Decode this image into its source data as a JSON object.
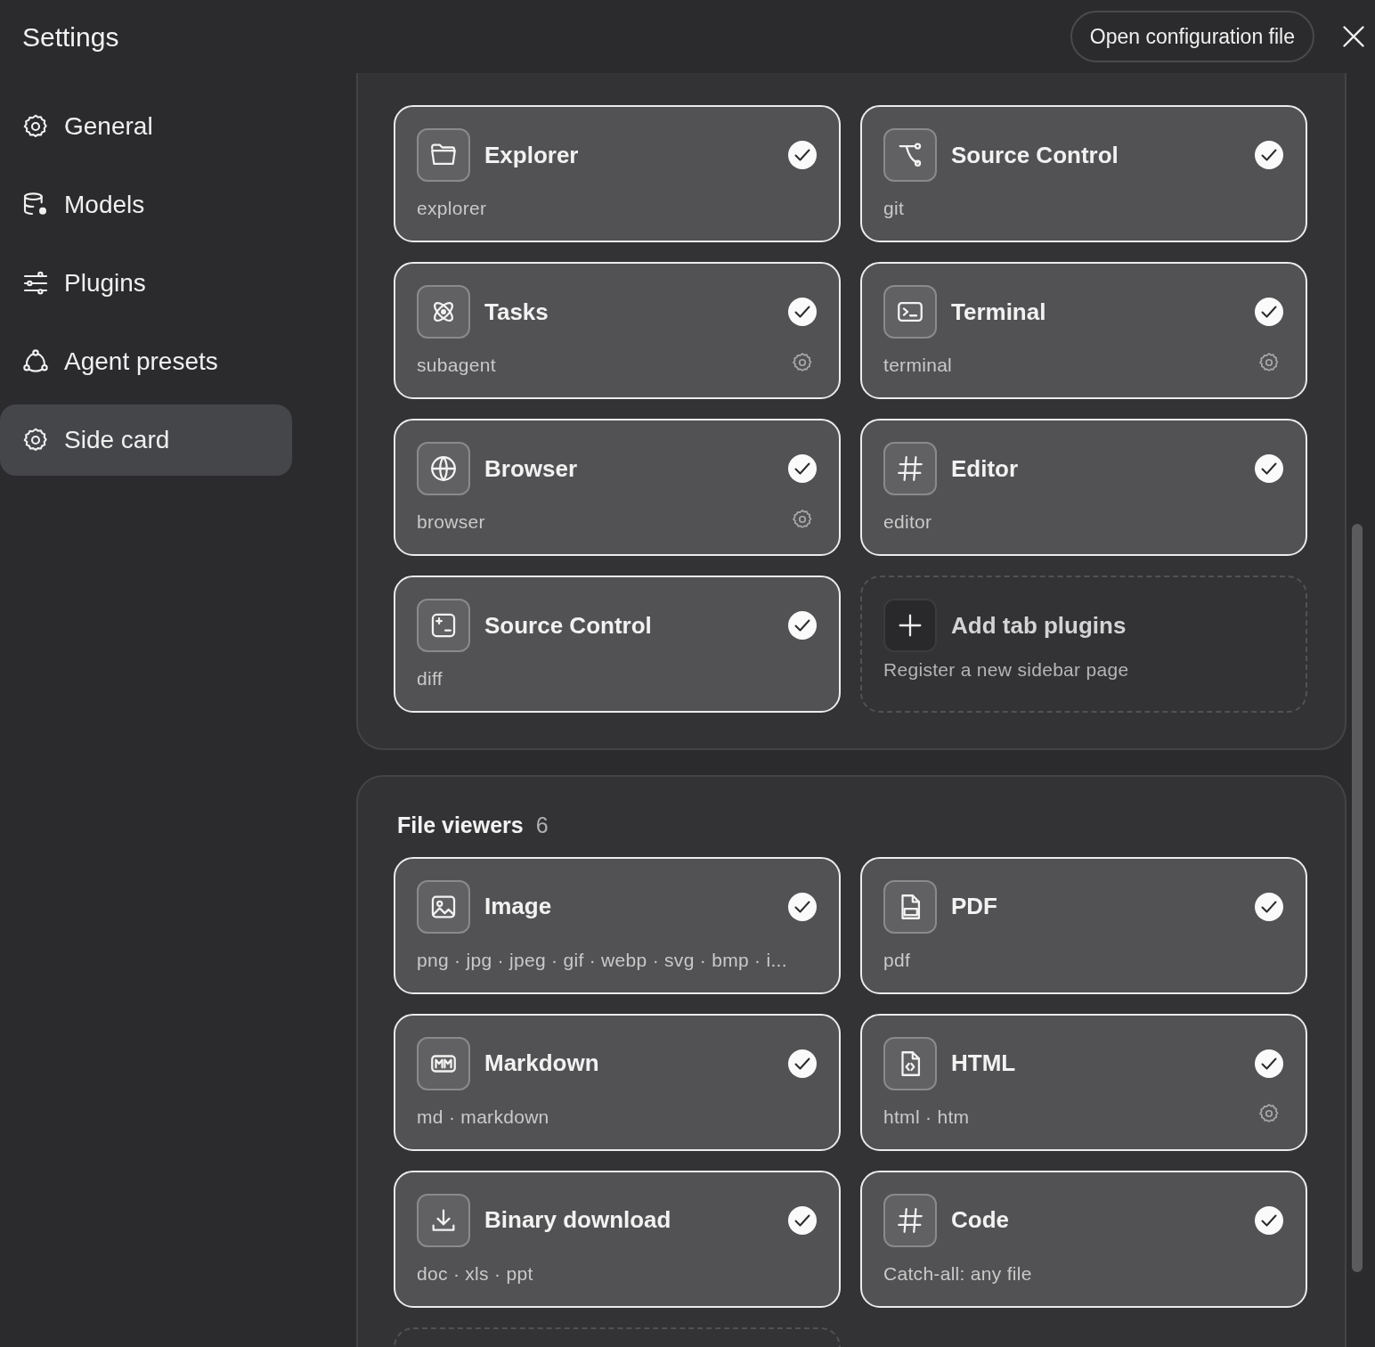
{
  "window": {
    "title": "Settings",
    "action_button": "Open configuration file"
  },
  "sidebar": {
    "items": [
      {
        "label": "General",
        "selected": false
      },
      {
        "label": "Models",
        "selected": false
      },
      {
        "label": "Plugins",
        "selected": false
      },
      {
        "label": "Agent presets",
        "selected": false
      },
      {
        "label": "Side card",
        "selected": true
      }
    ]
  },
  "sections": [
    {
      "items": [
        {
          "kind": "plugin",
          "title": "Explorer",
          "subtitle": "explorer",
          "checked": true,
          "settings": false
        },
        {
          "kind": "plugin",
          "title": "Source Control",
          "subtitle": "git",
          "checked": true,
          "settings": false
        },
        {
          "kind": "plugin",
          "title": "Tasks",
          "subtitle": "subagent",
          "checked": true,
          "settings": true
        },
        {
          "kind": "plugin",
          "title": "Terminal",
          "subtitle": "terminal",
          "checked": true,
          "settings": true
        },
        {
          "kind": "plugin",
          "title": "Browser",
          "subtitle": "browser",
          "checked": true,
          "settings": true
        },
        {
          "kind": "plugin",
          "title": "Editor",
          "subtitle": "editor",
          "checked": true,
          "settings": false
        },
        {
          "kind": "plugin",
          "title": "Source Control",
          "subtitle": "diff",
          "checked": true,
          "settings": false
        },
        {
          "kind": "add",
          "title": "Add tab plugins",
          "subtitle": "Register a new sidebar page"
        }
      ]
    },
    {
      "title": "File viewers",
      "count": "6",
      "items": [
        {
          "kind": "plugin",
          "title": "Image",
          "subtitle": "png · jpg · jpeg · gif · webp · svg · bmp · i...",
          "checked": true,
          "settings": false
        },
        {
          "kind": "plugin",
          "title": "PDF",
          "subtitle": "pdf",
          "checked": true,
          "settings": false
        },
        {
          "kind": "plugin",
          "title": "Markdown",
          "subtitle": "md · markdown",
          "checked": true,
          "settings": false
        },
        {
          "kind": "plugin",
          "title": "HTML",
          "subtitle": "html · htm",
          "checked": true,
          "settings": true
        },
        {
          "kind": "plugin",
          "title": "Binary download",
          "subtitle": "doc · xls · ppt",
          "checked": true,
          "settings": false
        },
        {
          "kind": "plugin",
          "title": "Code",
          "subtitle": "Catch-all: any file",
          "checked": true,
          "settings": false
        },
        {
          "kind": "add"
        }
      ]
    }
  ]
}
